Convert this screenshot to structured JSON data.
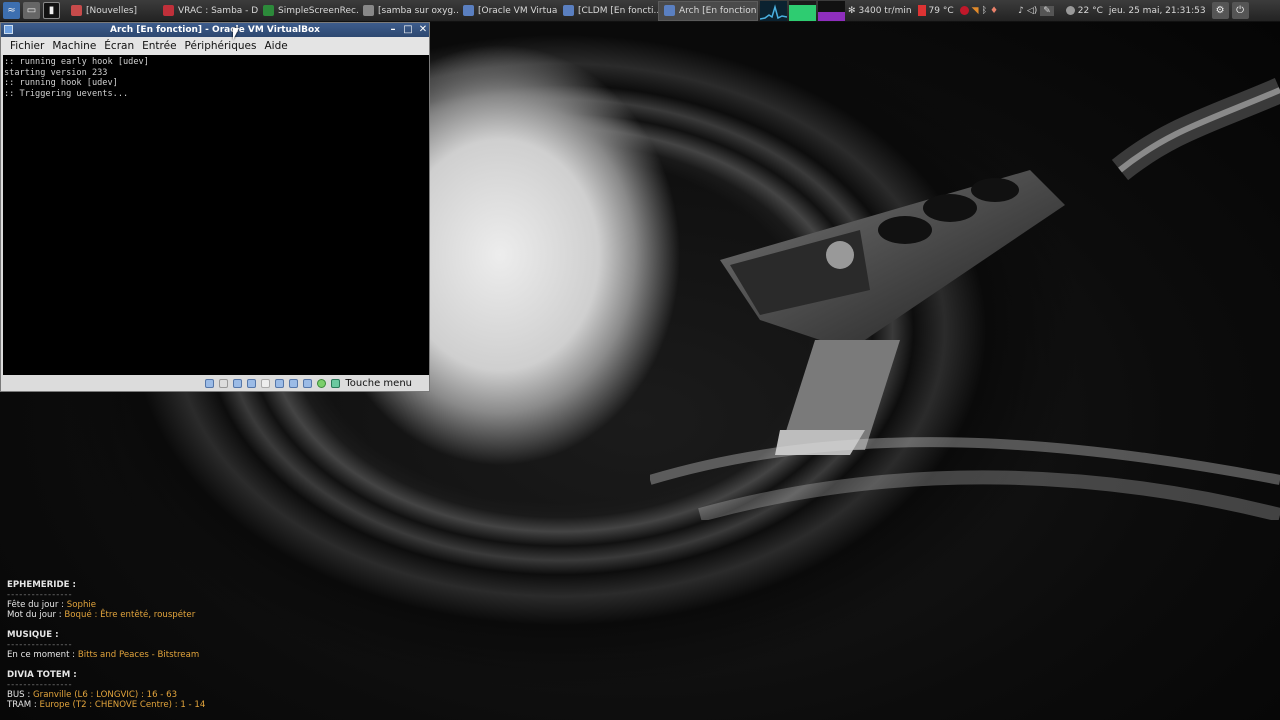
{
  "taskbar": {
    "tasks": [
      {
        "label": "[Nouvelles]",
        "color": "#c74b4b"
      },
      {
        "label": "VRAC : Samba - D...",
        "color": "#c0303a"
      },
      {
        "label": "SimpleScreenRec...",
        "color": "#2c8a3a"
      },
      {
        "label": "[samba sur oxyg...",
        "color": "#888888"
      },
      {
        "label": "[Oracle VM Virtua...",
        "color": "#5a7fc0"
      },
      {
        "label": "[CLDM [En foncti...",
        "color": "#5a7fc0"
      },
      {
        "label": "Arch [En fonction...",
        "color": "#5a7fc0"
      }
    ],
    "cpu_fan": "3400 tr/min",
    "cpu_temp": "79 °C",
    "weather": "22 °C",
    "datetime": "jeu. 25 mai, 21:31:53"
  },
  "vbox": {
    "title": "Arch [En fonction] - Oracle VM VirtualBox",
    "menu": [
      "Fichier",
      "Machine",
      "Écran",
      "Entrée",
      "Périphériques",
      "Aide"
    ],
    "console": [
      ":: running early hook [udev]",
      "starting version 233",
      ":: running hook [udev]",
      ":: Triggering uevents..."
    ],
    "host_key": "Touche menu"
  },
  "info": {
    "ephemeride_title": "EPHEMERIDE :",
    "fete_label": "Fête du jour :",
    "fete_value": "Sophie",
    "mot_label": "Mot du jour :",
    "mot_value": "Boqué : Être entêté, rouspéter",
    "musique_title": "MUSIQUE :",
    "moment_label": "En ce moment :",
    "moment_value": "Bitts and Peaces - Bitstream",
    "divia_title": "DIVIA TOTEM :",
    "bus_label": "BUS :",
    "bus_value": "Granville (L6 : LONGVIC) : 16 - 63",
    "tram_label": "TRAM :",
    "tram_value": "Europe (T2 : CHENOVE Centre) : 1 - 14",
    "underline": "----------------"
  }
}
